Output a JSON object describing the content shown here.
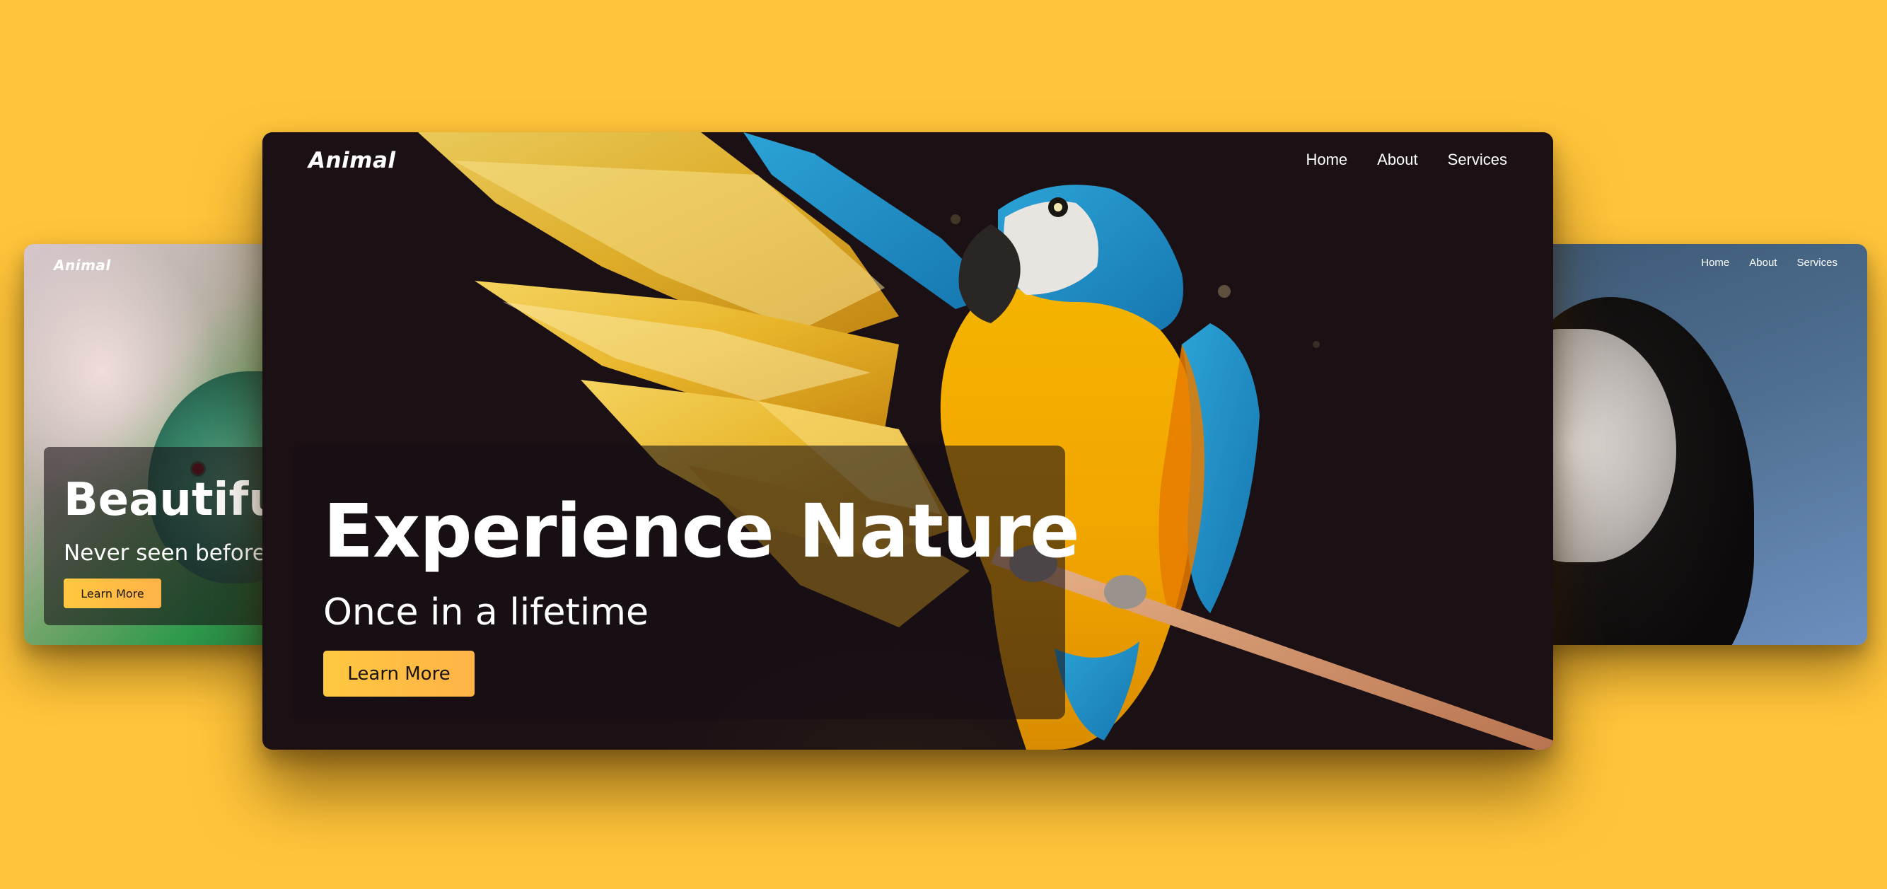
{
  "background_color": "#ffc53a",
  "accent_color": "#ffc840",
  "cards": {
    "left": {
      "logo": "Animal",
      "hero_title": "Beautifu",
      "hero_subtitle": "Never seen before",
      "cta_label": "Learn More"
    },
    "main": {
      "logo": "Animal",
      "nav": [
        "Home",
        "About",
        "Services"
      ],
      "hero_title": "Experience Nature",
      "hero_subtitle": "Once in a lifetime",
      "cta_label": "Learn More"
    },
    "right": {
      "nav": [
        "Home",
        "About",
        "Services"
      ]
    }
  }
}
